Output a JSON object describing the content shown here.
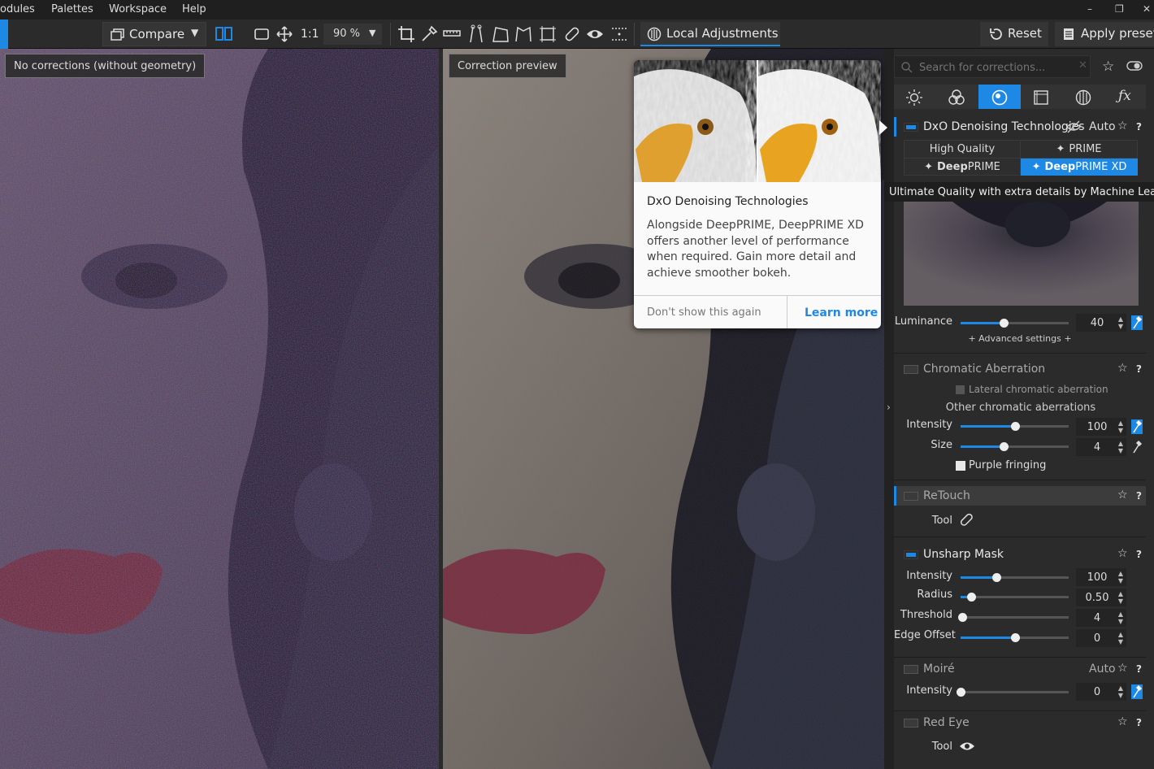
{
  "menubar": {
    "items": [
      "odules",
      "Palettes",
      "Workspace",
      "Help"
    ]
  },
  "toolbar": {
    "compare_label": "Compare",
    "one_to_one": "1:1",
    "zoom": "90 %",
    "local_adjustments": "Local Adjustments",
    "reset": "Reset",
    "apply_preset": "Apply preset"
  },
  "viewer": {
    "left_label": "No corrections (without geometry)",
    "right_label": "Correction preview"
  },
  "popup": {
    "title": "DxO Denoising Technologies",
    "body": "Alongside DeepPRIME, DeepPRIME XD offers another level of performance when required. Gain more detail and achieve smoother bokeh.",
    "dismiss": "Don't show this again",
    "learn_more": "Learn more"
  },
  "tooltip": "Ultimate Quality with extra details by Machine Learning",
  "panel": {
    "search_placeholder": "Search for corrections...",
    "denoise": {
      "title": "DxO Denoising Technologies",
      "auto": "Auto",
      "modes": [
        "High Quality",
        "PRIME",
        "DeepPRIME",
        "DeepPRIME XD"
      ],
      "mode_prefix": "Deep",
      "mode_suffix_1": "PRIME",
      "mode_suffix_2": "PRIME XD",
      "luminance_label": "Luminance",
      "luminance_value": "40",
      "luminance": 40,
      "advanced": "+ Advanced settings +"
    },
    "chromatic": {
      "title": "Chromatic Aberration",
      "lateral": "Lateral chromatic aberration",
      "other": "Other chromatic aberrations",
      "intensity_label": "Intensity",
      "intensity_value": "100",
      "intensity": 100,
      "size_label": "Size",
      "size_value": "4",
      "size": 4,
      "purple": "Purple fringing"
    },
    "retouch": {
      "title": "ReTouch",
      "tool_label": "Tool"
    },
    "unsharp": {
      "title": "Unsharp Mask",
      "intensity_label": "Intensity",
      "intensity_value": "100",
      "intensity": 100,
      "radius_label": "Radius",
      "radius_value": "0.50",
      "radius": 0.5,
      "threshold_label": "Threshold",
      "threshold_value": "4",
      "threshold": 4,
      "edge_label": "Edge Offset",
      "edge_value": "0",
      "edge": 0
    },
    "moire": {
      "title": "Moiré",
      "auto": "Auto",
      "intensity_label": "Intensity",
      "intensity_value": "0",
      "intensity": 0
    },
    "redeye": {
      "title": "Red Eye",
      "tool_label": "Tool"
    },
    "help_glyph": "?"
  },
  "colors": {
    "accent": "#1e88e5",
    "panel_bg": "#2b2b2b",
    "toolbar_bg": "#2b2b2b"
  }
}
